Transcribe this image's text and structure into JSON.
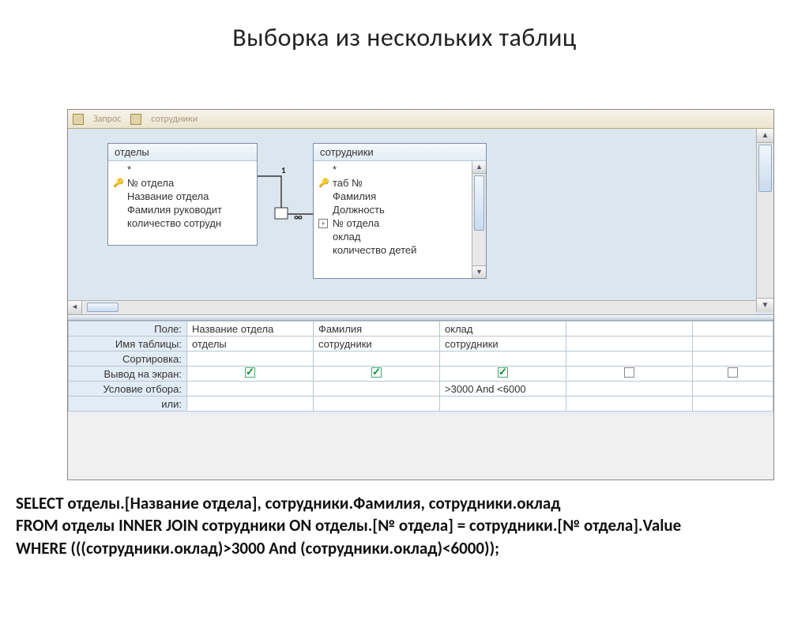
{
  "title": "Выборка из нескольких таблиц",
  "tabs": {
    "t1": "Запрос",
    "t2": "сотрудники"
  },
  "tables": {
    "left": {
      "title": "отделы",
      "fields": [
        "*",
        "№ отдела",
        "Название отдела",
        "Фамилия руководит",
        "количество сотрудн"
      ]
    },
    "right": {
      "title": "сотрудники",
      "fields": [
        "*",
        "таб №",
        "Фамилия",
        "Должность",
        "№ отдела",
        "оклад",
        "количество детей"
      ]
    }
  },
  "join": {
    "left_label": "1",
    "right_label": "∞"
  },
  "grid": {
    "rows": {
      "field": "Поле:",
      "table": "Имя таблицы:",
      "sort": "Сортировка:",
      "show": "Вывод на экран:",
      "criteria": "Условие отбора:",
      "or": "или:"
    },
    "cols": [
      {
        "field": "Название отдела",
        "table": "отделы",
        "show": true,
        "criteria": ""
      },
      {
        "field": "Фамилия",
        "table": "сотрудники",
        "show": true,
        "criteria": ""
      },
      {
        "field": "оклад",
        "table": "сотрудники",
        "show": true,
        "criteria": ">3000 And <6000"
      },
      {
        "field": "",
        "table": "",
        "show": false,
        "criteria": ""
      }
    ]
  },
  "sql": {
    "l1": "SELECT отделы.[Название отдела], сотрудники.Фамилия, сотрудники.оклад",
    "l2": "FROM отделы INNER JOIN сотрудники ON отделы.[№ отдела] = сотрудники.[№ отдела].Value",
    "l3": "WHERE (((сотрудники.оклад)>3000 And (сотрудники.оклад)<6000));"
  }
}
